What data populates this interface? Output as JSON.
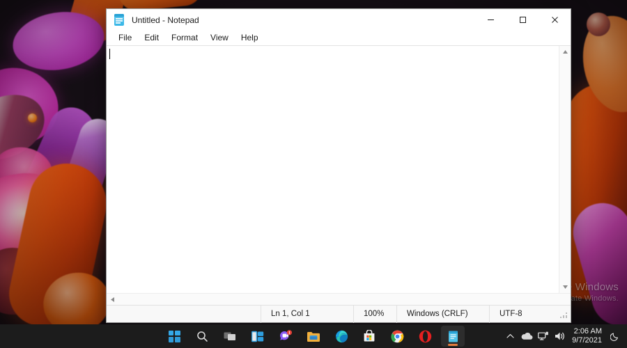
{
  "desktop": {
    "watermark_line1": "Activate Windows",
    "watermark_line2": "Go to Settings to activate Windows."
  },
  "notepad": {
    "icon_name": "notepad-icon",
    "title": "Untitled - Notepad",
    "menu": [
      {
        "label": "File"
      },
      {
        "label": "Edit"
      },
      {
        "label": "Format"
      },
      {
        "label": "View"
      },
      {
        "label": "Help"
      }
    ],
    "window_controls": {
      "minimize": "Minimize",
      "maximize": "Maximize",
      "close": "Close"
    },
    "editor": {
      "content": "",
      "caret_visible": true
    },
    "statusbar": {
      "position": "Ln 1, Col 1",
      "zoom": "100%",
      "line_ending": "Windows (CRLF)",
      "encoding": "UTF-8"
    }
  },
  "taskbar": {
    "items": [
      {
        "name": "start-button",
        "label": "Start"
      },
      {
        "name": "search-button",
        "label": "Search"
      },
      {
        "name": "task-view-button",
        "label": "Task View"
      },
      {
        "name": "widgets-button",
        "label": "Widgets"
      },
      {
        "name": "chat-button",
        "label": "Chat",
        "badge": "!"
      },
      {
        "name": "file-explorer-button",
        "label": "File Explorer"
      },
      {
        "name": "edge-button",
        "label": "Microsoft Edge"
      },
      {
        "name": "store-button",
        "label": "Microsoft Store"
      },
      {
        "name": "chrome-button",
        "label": "Google Chrome"
      },
      {
        "name": "opera-button",
        "label": "Opera"
      },
      {
        "name": "notepad-taskbar-button",
        "label": "Notepad",
        "active": true
      }
    ],
    "tray": {
      "show_hidden": "Show hidden icons",
      "onedrive": "OneDrive",
      "network": "Network",
      "volume": "Volume",
      "time": "2:06 AM",
      "date": "9/7/2021",
      "notifications": "Notifications"
    }
  },
  "colors": {
    "accent": "#0078d4",
    "taskbar_bg": "#1c1c1c",
    "window_bg": "#ffffff",
    "active_underline": "#e27c3e"
  }
}
